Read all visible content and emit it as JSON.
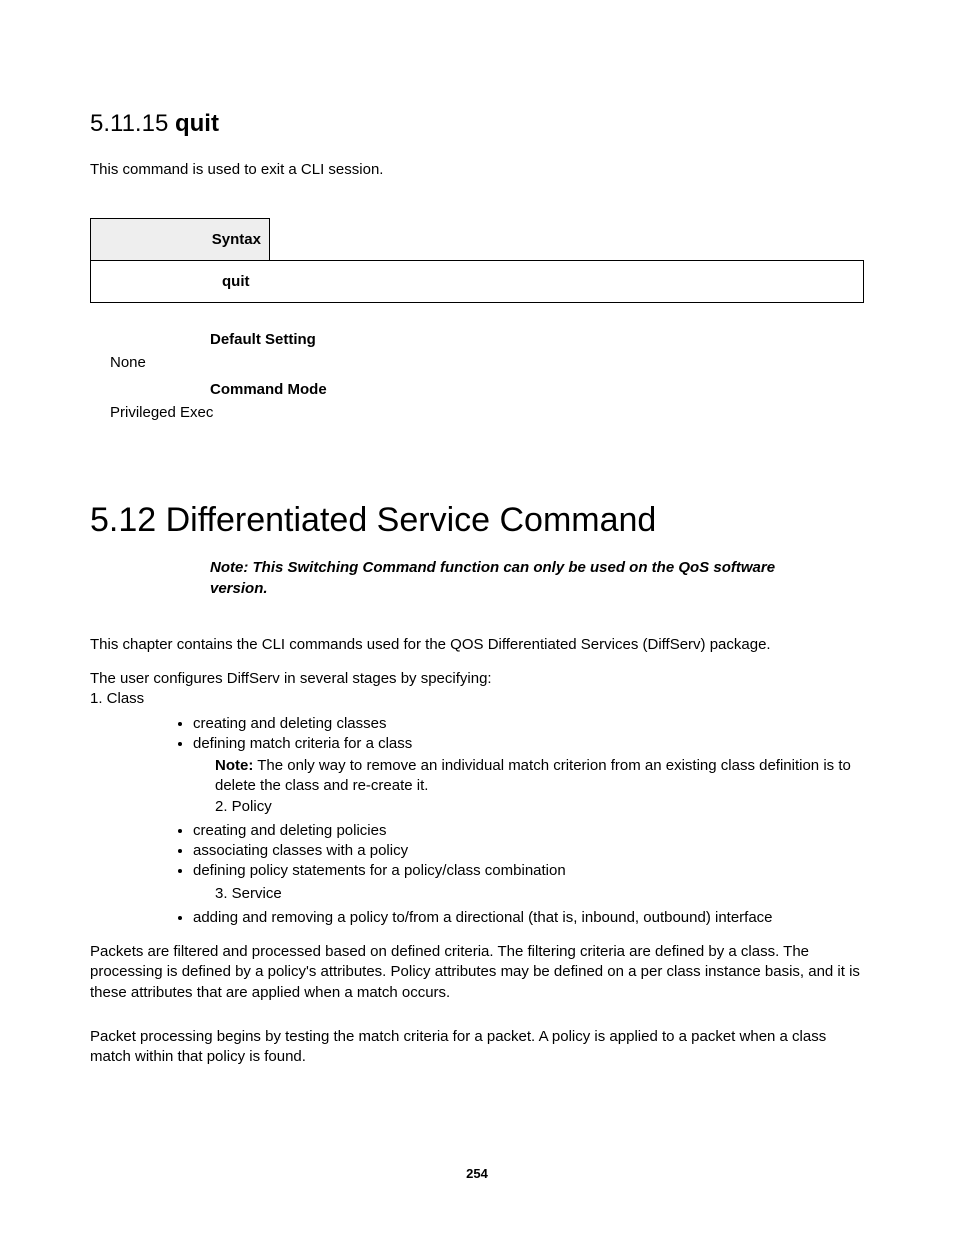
{
  "section1": {
    "num": "5.11.15",
    "title": "quit",
    "desc": "This command is used to exit a CLI session.",
    "syntax_label": "Syntax",
    "syntax_body": "quit",
    "default_label": "Default Setting",
    "default_value": "None",
    "mode_label": "Command Mode",
    "mode_value": "Privileged Exec"
  },
  "section2": {
    "heading": "5.12 Differentiated Service Command",
    "note": "Note: This Switching Command function can only be used on the QoS software version.",
    "para1": "This chapter contains the CLI commands used for the QOS Differentiated Services (DiffServ) package.",
    "para2a": "The user configures DiffServ in several stages by specifying:",
    "stage1": "1. Class",
    "bullets1": [
      "creating and deleting classes",
      "defining match criteria for a class"
    ],
    "note_label": "Note:",
    "note_text": " The only way to remove an individual match criterion from an existing class definition is to delete the class and re-create it.",
    "stage2": "2. Policy",
    "bullets2": [
      "creating and deleting policies",
      "associating classes with a policy",
      "defining policy statements for a policy/class combination"
    ],
    "stage3": "3. Service",
    "bullets3": [
      "adding and removing a policy to/from a directional (that is, inbound, outbound) interface"
    ],
    "para3": "Packets are filtered and processed based on defined criteria. The filtering criteria are defined by a class. The processing is defined by a policy's attributes. Policy attributes may be defined on a per class instance basis, and it is these attributes that are applied when a match occurs.",
    "para4": "Packet processing begins by testing the match criteria for a packet. A policy is applied to a packet when a class match within that policy is found."
  },
  "page_number": "254"
}
